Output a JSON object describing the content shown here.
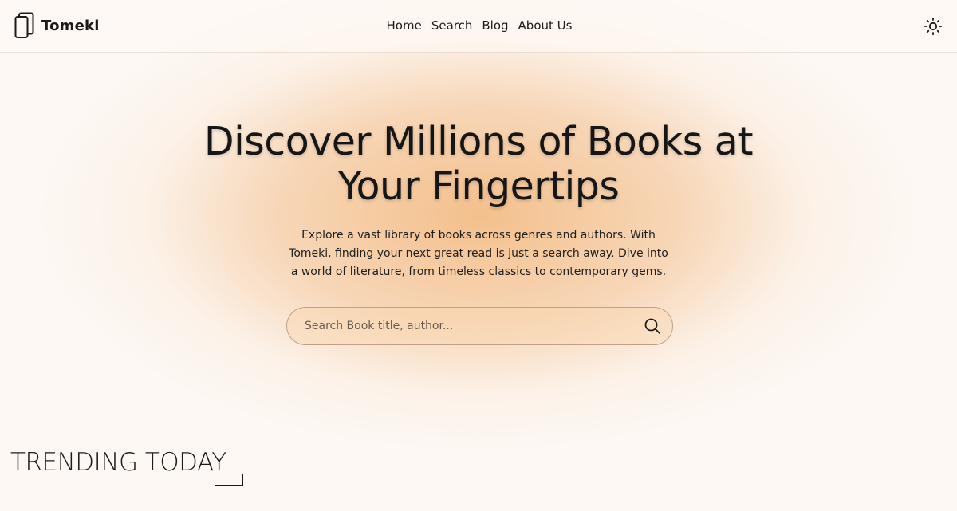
{
  "header": {
    "brand": "Tomeki",
    "logo_icon": "books-icon",
    "nav": [
      {
        "label": "Home"
      },
      {
        "label": "Search"
      },
      {
        "label": "Blog"
      },
      {
        "label": "About Us"
      }
    ],
    "theme_icon": "sun-icon"
  },
  "hero": {
    "title": "Discover Millions of Books at Your Fingertips",
    "description": "Explore a vast library of books across genres and authors. With Tomeki, finding your next great read is just a search away. Dive into a world of literature, from timeless classics to contemporary gems.",
    "search": {
      "placeholder": "Search Book title, author...",
      "value": "",
      "button_icon": "search-icon"
    }
  },
  "trending": {
    "title": "TRENDING TODAY"
  },
  "colors": {
    "accent_glow": "#f2b67a",
    "background": "#fdf8f4",
    "text": "#1b1b1b"
  }
}
